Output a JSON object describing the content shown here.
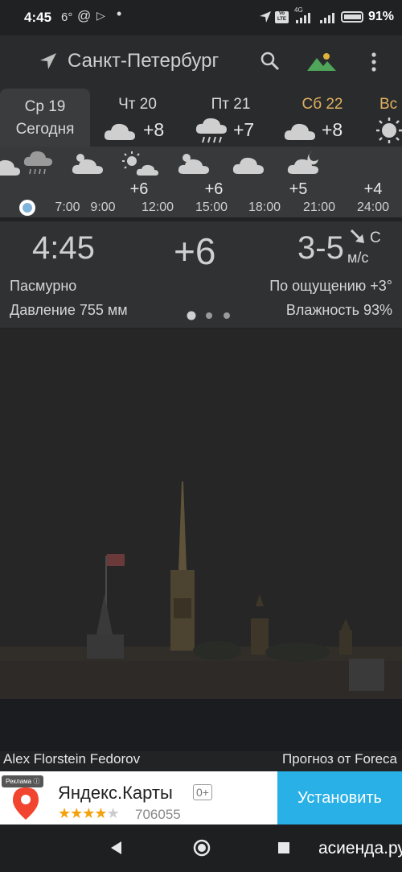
{
  "status_bar": {
    "time": "4:45",
    "indicator_temp": "6°",
    "network_type": "4G",
    "volte": "Vo LTE",
    "battery": "91%"
  },
  "header": {
    "city": "Санкт-Петербург",
    "icons": [
      "location-arrow-icon",
      "search-icon",
      "landscape-icon",
      "more-vert-icon"
    ]
  },
  "days": [
    {
      "label": "Ср 19",
      "sub": "Сегодня",
      "selected": true,
      "color": "#d8d8d8"
    },
    {
      "label": "Чт 20",
      "icon": "cloud-icon",
      "temp": "+8",
      "color": "#d8d8d8"
    },
    {
      "label": "Пт 21",
      "icon": "cloud-rain-icon",
      "temp": "+7",
      "color": "#d8d8d8"
    },
    {
      "label": "Сб 22",
      "icon": "cloud-icon",
      "temp": "+8",
      "color": "#e0b060"
    },
    {
      "label": "Вс",
      "icon": "sun-icon",
      "color": "#e0b060"
    }
  ],
  "hourly": {
    "temps": [
      "+6",
      "+6",
      "+5",
      "+4"
    ],
    "times": [
      "7:00",
      "9:00",
      "12:00",
      "15:00",
      "18:00",
      "21:00",
      "24:00"
    ]
  },
  "current": {
    "time": "4:45",
    "temp": "+6",
    "wind_speed": "3-5",
    "wind_dir": "С",
    "wind_unit": "м/с",
    "condition": "Пасмурно",
    "feels_like": "По ощущению +3°",
    "pressure": "Давление 755 мм",
    "humidity": "Влажность 93%"
  },
  "credits": {
    "photo_author": "Alex Florstein Fedorov",
    "forecast_by": "Прогноз от Foreca"
  },
  "ad": {
    "badge": "Реклама",
    "app_name": "Яндекс.Карты",
    "age_rating": "0+",
    "rating_count": "706055",
    "stars": 4,
    "button": "Установить"
  },
  "watermark": "асиенда.ру",
  "colors": {
    "accent_day": "#e0b060",
    "install_button": "#29b0e6",
    "location_dot": "#7fb3d9"
  }
}
